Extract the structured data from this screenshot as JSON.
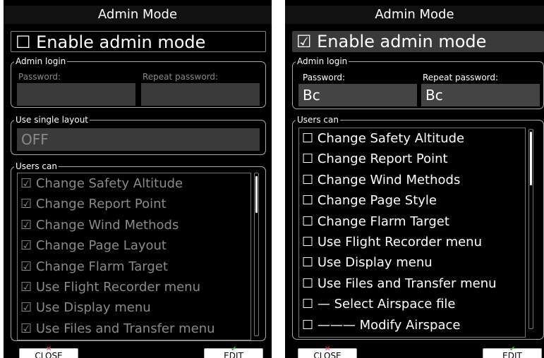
{
  "left": {
    "title": "Admin Mode",
    "enable_label": "☐ Enable admin mode",
    "admin_login": {
      "legend": "Admin login",
      "password_label": "Password:",
      "repeat_label": "Repeat password:",
      "password_value": "",
      "repeat_value": ""
    },
    "single_layout": {
      "legend": "Use single layout",
      "value": "OFF"
    },
    "users_can": {
      "legend": "Users can",
      "items": [
        "☑ Change Safety Altitude",
        "☑ Change Report Point",
        "☑ Change Wind Methods",
        "☑ Change Page Layout",
        "☑ Change Flarm Target",
        "☑ Use Flight Recorder menu",
        "☑ Use Display menu",
        "☑ Use Files and Transfer menu"
      ]
    },
    "close_label": "CLOSE",
    "edit_label": "EDIT"
  },
  "right": {
    "title": "Admin Mode",
    "enable_label": "☑ Enable admin mode",
    "admin_login": {
      "legend": "Admin login",
      "password_label": "Password:",
      "repeat_label": "Repeat password:",
      "password_value": "Bc",
      "repeat_value": "Bc"
    },
    "users_can": {
      "legend": "Users can",
      "items": [
        "☐ Change Safety Altitude",
        "☐ Change Report Point",
        "☐ Change Wind Methods",
        "☐ Change Page Style",
        "☐ Change Flarm Target",
        "☐ Use Flight Recorder menu",
        "☐ Use Display menu",
        "☐ Use Files and Transfer menu",
        "☐ — Select Airspace file",
        "☐ ——— Modify Airspace"
      ]
    },
    "close_label": "CLOSE",
    "edit_label": "EDIT"
  },
  "colors": {
    "close_icon": "#e04040",
    "edit_icon": "#40c040"
  },
  "icons": {
    "close": "x-icon",
    "edit": "check-icon"
  }
}
